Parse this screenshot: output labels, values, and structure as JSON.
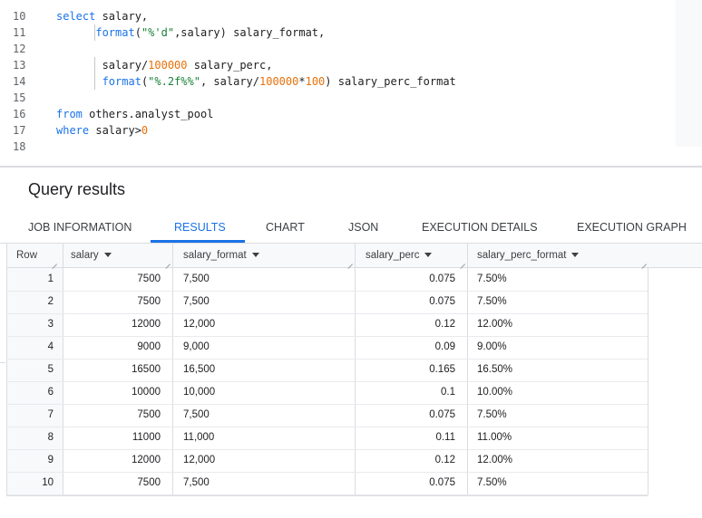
{
  "editor": {
    "lines": [
      {
        "n": "10",
        "parts": [
          {
            "t": "select",
            "c": "kw"
          },
          {
            "t": " salary,",
            "c": ""
          }
        ]
      },
      {
        "n": "11",
        "parts": [
          {
            "t": "      ",
            "c": ""
          },
          {
            "t": "format",
            "c": "fn"
          },
          {
            "t": "(",
            "c": ""
          },
          {
            "t": "\"%'d\"",
            "c": "str"
          },
          {
            "t": ",salary) salary_format,",
            "c": ""
          }
        ]
      },
      {
        "n": "12",
        "parts": []
      },
      {
        "n": "13",
        "parts": [
          {
            "t": "       salary/",
            "c": ""
          },
          {
            "t": "100000",
            "c": "num"
          },
          {
            "t": " salary_perc,",
            "c": ""
          }
        ]
      },
      {
        "n": "14",
        "parts": [
          {
            "t": "       ",
            "c": ""
          },
          {
            "t": "format",
            "c": "fn"
          },
          {
            "t": "(",
            "c": ""
          },
          {
            "t": "\"%.2f%%\"",
            "c": "str"
          },
          {
            "t": ", salary/",
            "c": ""
          },
          {
            "t": "100000",
            "c": "num"
          },
          {
            "t": "*",
            "c": ""
          },
          {
            "t": "100",
            "c": "num"
          },
          {
            "t": ") salary_perc_format",
            "c": ""
          }
        ]
      },
      {
        "n": "15",
        "parts": []
      },
      {
        "n": "16",
        "parts": [
          {
            "t": "from",
            "c": "kw"
          },
          {
            "t": " others.analyst_pool",
            "c": ""
          }
        ]
      },
      {
        "n": "17",
        "parts": [
          {
            "t": "where",
            "c": "kw"
          },
          {
            "t": " salary>",
            "c": ""
          },
          {
            "t": "0",
            "c": "num"
          }
        ]
      },
      {
        "n": "18",
        "parts": []
      }
    ]
  },
  "results": {
    "title": "Query results",
    "tabs": [
      "JOB INFORMATION",
      "RESULTS",
      "CHART",
      "JSON",
      "EXECUTION DETAILS",
      "EXECUTION GRAPH"
    ],
    "active_tab": "RESULTS",
    "columns": [
      "Row",
      "salary",
      "salary_format",
      "salary_perc",
      "salary_perc_format"
    ],
    "rows": [
      [
        "1",
        "7500",
        "7,500",
        "0.075",
        "7.50%"
      ],
      [
        "2",
        "7500",
        "7,500",
        "0.075",
        "7.50%"
      ],
      [
        "3",
        "12000",
        "12,000",
        "0.12",
        "12.00%"
      ],
      [
        "4",
        "9000",
        "9,000",
        "0.09",
        "9.00%"
      ],
      [
        "5",
        "16500",
        "16,500",
        "0.165",
        "16.50%"
      ],
      [
        "6",
        "10000",
        "10,000",
        "0.1",
        "10.00%"
      ],
      [
        "7",
        "7500",
        "7,500",
        "0.075",
        "7.50%"
      ],
      [
        "8",
        "11000",
        "11,000",
        "0.11",
        "11.00%"
      ],
      [
        "9",
        "12000",
        "12,000",
        "0.12",
        "12.00%"
      ],
      [
        "10",
        "7500",
        "7,500",
        "0.075",
        "7.50%"
      ]
    ]
  }
}
